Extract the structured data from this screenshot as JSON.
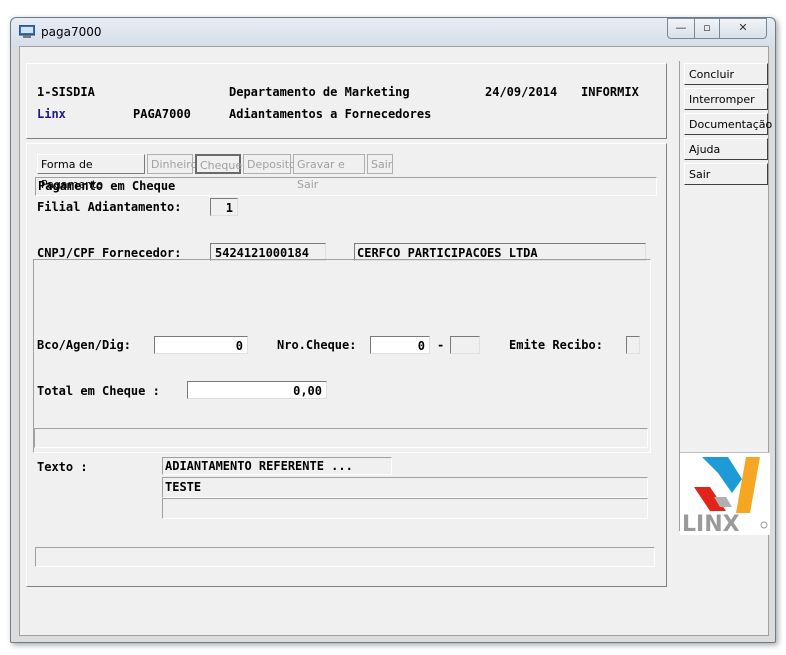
{
  "window": {
    "title": "paga7000",
    "minimize": "—",
    "maximize": "▫",
    "close": "✕"
  },
  "header": {
    "system": "1-SISDIA",
    "department": "Departamento de Marketing",
    "date": "24/09/2014",
    "db": "INFORMIX",
    "company": "Linx",
    "program": "PAGA7000",
    "subtitle": "Adiantamentos a Fornecedores"
  },
  "tabs": [
    {
      "label": "Forma de Pagamento",
      "state": "active"
    },
    {
      "label": "Dinheiro",
      "state": "disabled"
    },
    {
      "label": "Cheque",
      "state": "selected"
    },
    {
      "label": "Deposito",
      "state": "disabled"
    },
    {
      "label": "Gravar e Sair",
      "state": "disabled"
    },
    {
      "label": "Sair",
      "state": "disabled"
    }
  ],
  "form": {
    "section_title": "Pagamento em Cheque",
    "filial_label": "Filial Adiantamento:",
    "filial_value": "1",
    "cnpj_label": "CNPJ/CPF Fornecedor:",
    "cnpj_value": "5424121000184",
    "fornecedor_name": "CERFCO PARTICIPACOES LTDA",
    "bco_label": "Bco/Agen/Dig:",
    "bco_value": "0",
    "nro_cheque_label": "Nro.Cheque:",
    "nro_cheque_value": "0",
    "nro_cheque_sep": "-",
    "nro_cheque_digit": "",
    "emite_recibo_label": "Emite Recibo:",
    "emite_recibo_value": "",
    "total_label": "Total em Cheque :",
    "total_value": "0,00",
    "status_line": "",
    "texto_label": "Texto :",
    "texto_header": "ADIANTAMENTO REFERENTE ...",
    "texto_line1": "TESTE",
    "texto_line2": "",
    "bottom_status": ""
  },
  "sidebar": {
    "buttons": [
      "Concluir",
      "Interromper",
      "Documentação",
      "Ajuda",
      "Sair"
    ]
  },
  "logo": {
    "text": "LINX",
    "colors": {
      "blue": "#1e9bd7",
      "orange": "#f5a623",
      "red": "#e2231a",
      "gray": "#9a9a9a"
    }
  }
}
